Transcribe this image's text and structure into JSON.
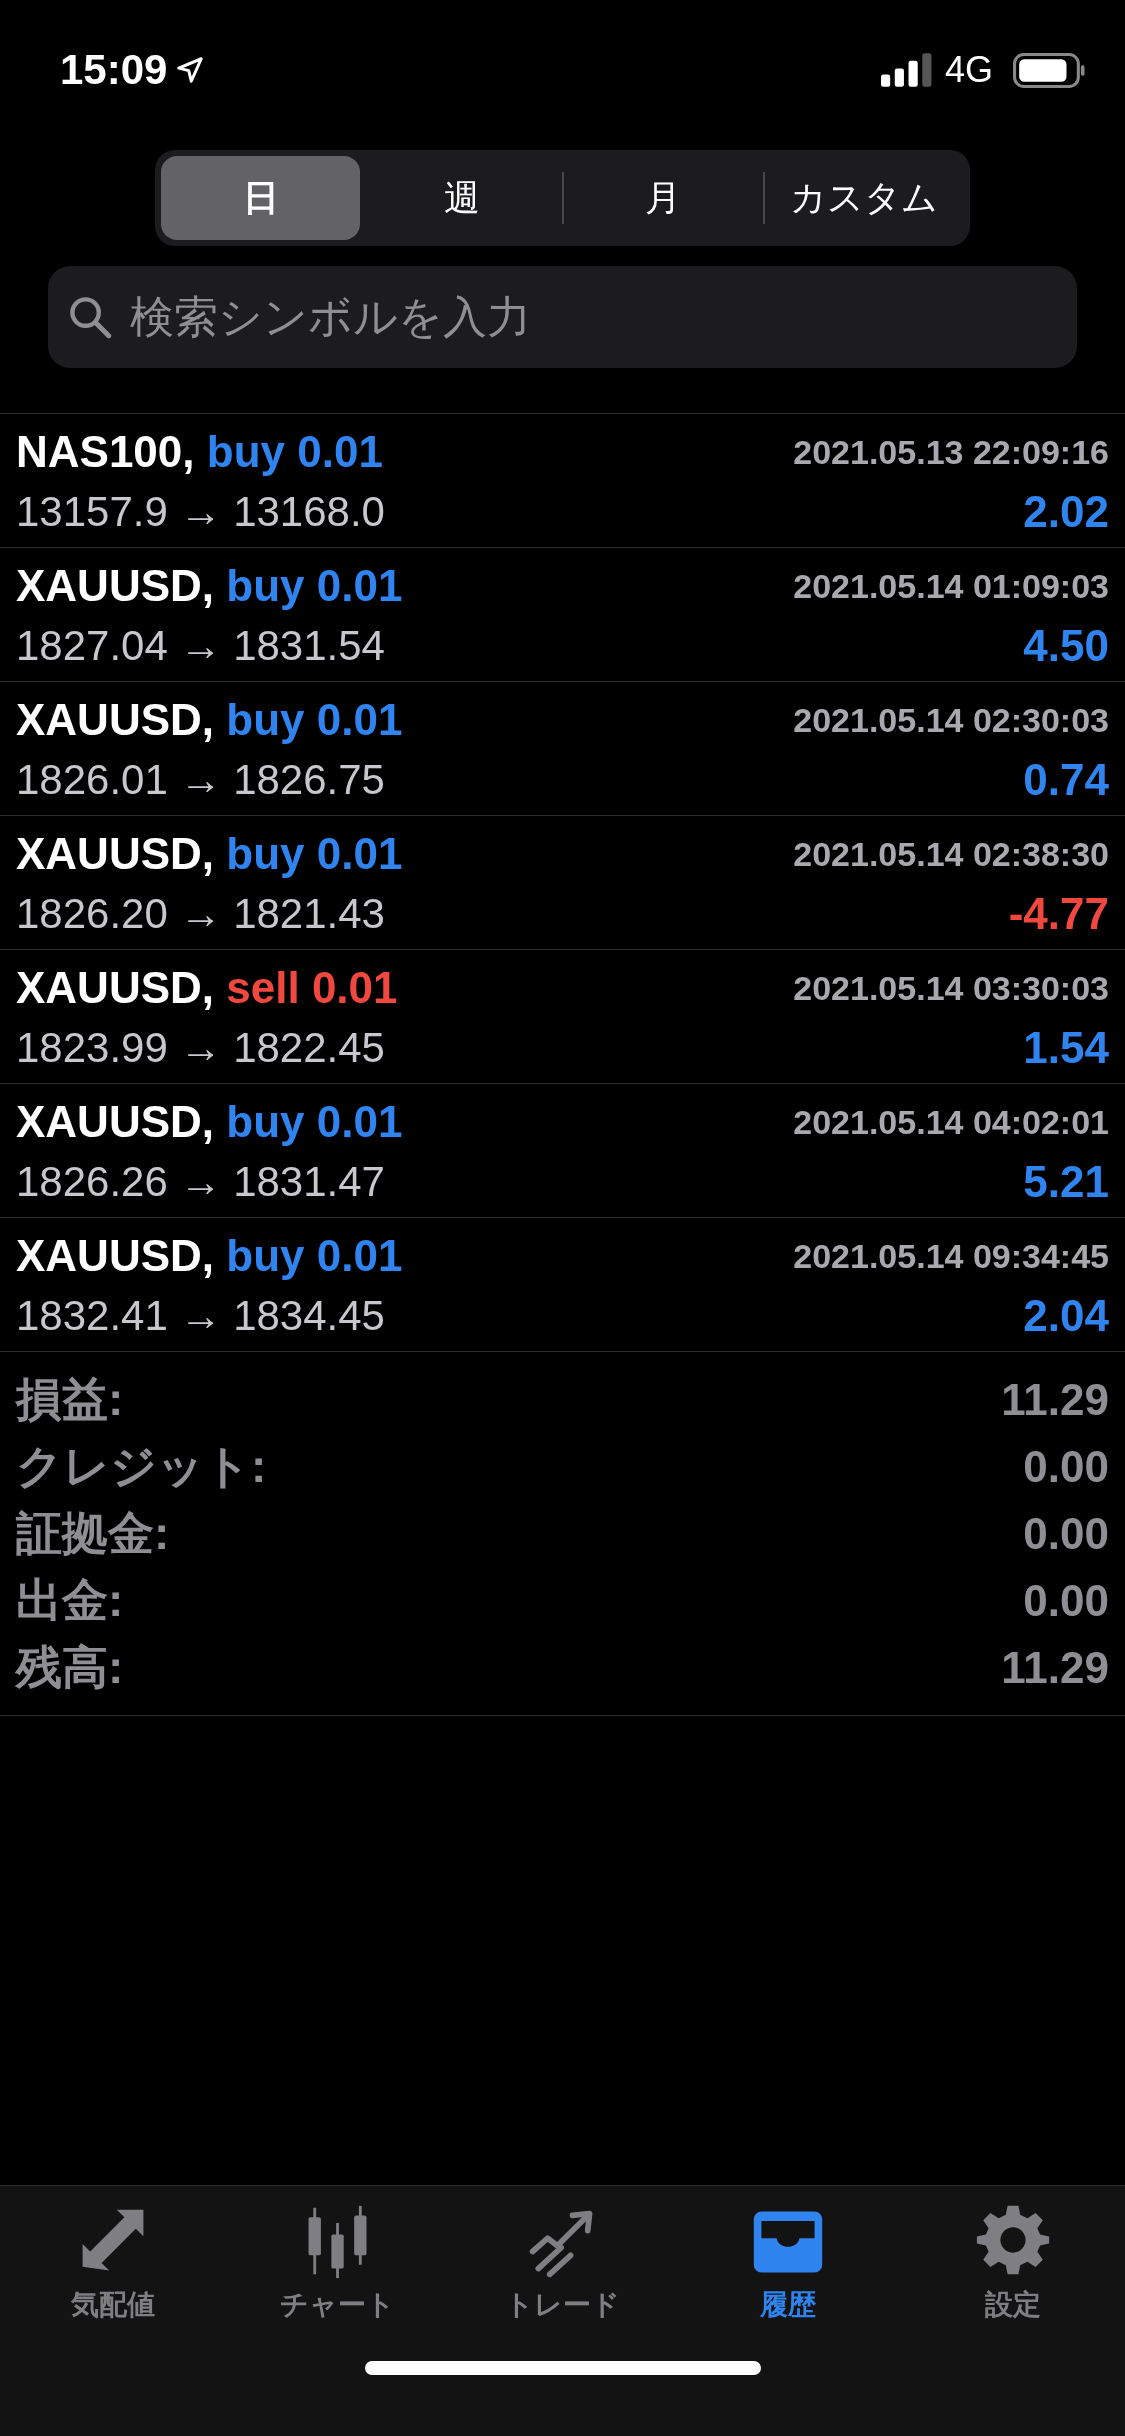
{
  "status_bar": {
    "time": "15:09",
    "network": "4G"
  },
  "period_tabs": [
    {
      "label": "日",
      "selected": true
    },
    {
      "label": "週",
      "selected": false
    },
    {
      "label": "月",
      "selected": false
    },
    {
      "label": "カスタム",
      "selected": false
    }
  ],
  "search": {
    "placeholder": "検索シンボルを入力"
  },
  "trades": [
    {
      "symbol": "NAS100,",
      "order": "buy 0.01",
      "kind": "buy",
      "time": "2021.05.13 22:09:16",
      "prices": "13157.9 → 13168.0",
      "profit": "2.02",
      "loss": false
    },
    {
      "symbol": "XAUUSD,",
      "order": "buy 0.01",
      "kind": "buy",
      "time": "2021.05.14 01:09:03",
      "prices": "1827.04 → 1831.54",
      "profit": "4.50",
      "loss": false
    },
    {
      "symbol": "XAUUSD,",
      "order": "buy 0.01",
      "kind": "buy",
      "time": "2021.05.14 02:30:03",
      "prices": "1826.01 → 1826.75",
      "profit": "0.74",
      "loss": false
    },
    {
      "symbol": "XAUUSD,",
      "order": "buy 0.01",
      "kind": "buy",
      "time": "2021.05.14 02:38:30",
      "prices": "1826.20 → 1821.43",
      "profit": "-4.77",
      "loss": true
    },
    {
      "symbol": "XAUUSD,",
      "order": "sell 0.01",
      "kind": "sell",
      "time": "2021.05.14 03:30:03",
      "prices": "1823.99 → 1822.45",
      "profit": "1.54",
      "loss": false
    },
    {
      "symbol": "XAUUSD,",
      "order": "buy 0.01",
      "kind": "buy",
      "time": "2021.05.14 04:02:01",
      "prices": "1826.26 → 1831.47",
      "profit": "5.21",
      "loss": false
    },
    {
      "symbol": "XAUUSD,",
      "order": "buy 0.01",
      "kind": "buy",
      "time": "2021.05.14 09:34:45",
      "prices": "1832.41 → 1834.45",
      "profit": "2.04",
      "loss": false
    }
  ],
  "summary": [
    {
      "label": "損益:",
      "value": "11.29"
    },
    {
      "label": "クレジット:",
      "value": "0.00"
    },
    {
      "label": "証拠金:",
      "value": "0.00"
    },
    {
      "label": "出金:",
      "value": "0.00"
    },
    {
      "label": "残高:",
      "value": "11.29"
    }
  ],
  "tab_bar": [
    {
      "label": "気配値",
      "selected": false
    },
    {
      "label": "チャート",
      "selected": false
    },
    {
      "label": "トレード",
      "selected": false
    },
    {
      "label": "履歴",
      "selected": true
    },
    {
      "label": "設定",
      "selected": false
    }
  ]
}
